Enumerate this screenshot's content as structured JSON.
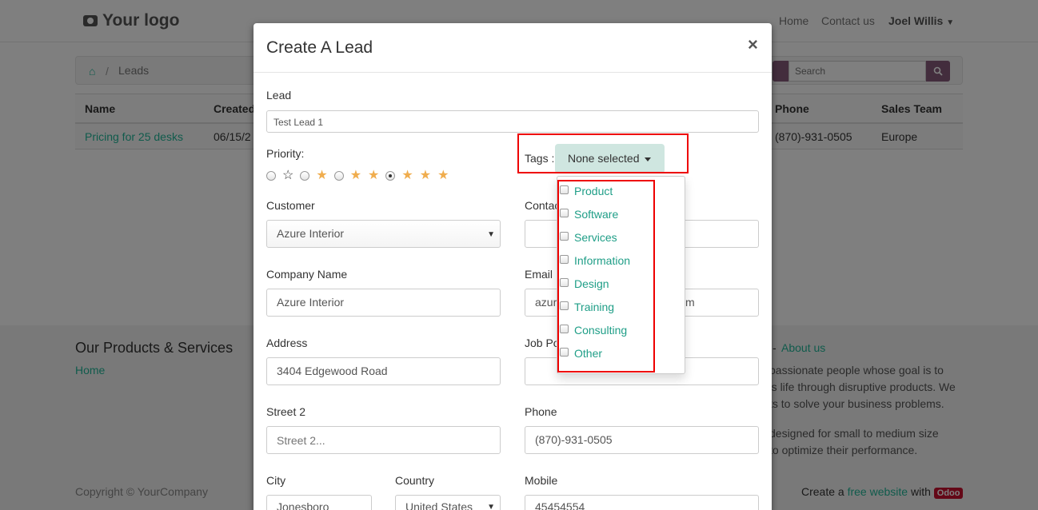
{
  "nav": {
    "logo_text": "Your logo",
    "home": "Home",
    "contact": "Contact us",
    "user": "Joel Willis"
  },
  "breadcrumb": {
    "current": "Leads"
  },
  "search": {
    "placeholder": "Search"
  },
  "table": {
    "headers": [
      "Name",
      "Created",
      "Phone",
      "Sales Team"
    ],
    "row": {
      "name": "Pricing for 25 desks",
      "created": "06/15/2",
      "phone": "(870)-931-0505",
      "team": "Europe"
    }
  },
  "footer": {
    "title": "Our Products & Services",
    "home": "Home",
    "about_prefix": "-",
    "about_link": "About us",
    "about_lines": [
      "passionate people whose goal is to",
      "'s life through disruptive products. We",
      "ts to solve your business problems."
    ],
    "about_lines2": [
      "designed for small to medium size",
      "to optimize their performance."
    ],
    "copyright": "Copyright © YourCompany",
    "create_prefix": "Create a",
    "create_link": "free website",
    "create_with": "with",
    "odoo": "Odoo"
  },
  "modal": {
    "title": "Create A Lead",
    "close": "×",
    "lead_label": "Lead",
    "lead_value": "Test Lead 1",
    "priority_label": "Priority:",
    "tags_label": "Tags :",
    "tags_button": "None selected",
    "tag_options": [
      "Product",
      "Software",
      "Services",
      "Information",
      "Design",
      "Training",
      "Consulting",
      "Other"
    ],
    "customer_label": "Customer",
    "customer_value": "Azure Interior",
    "contact_label": "Contac",
    "company_label": "Company Name",
    "company_value": "Azure Interior",
    "email_label": "Email",
    "email_value_left": "azur",
    "email_value_right": "m",
    "address_label": "Address",
    "address_value": "3404  Edgewood Road",
    "job_label": "Job Po",
    "street2_label": "Street 2",
    "street2_placeholder": "Street 2...",
    "phone_label": "Phone",
    "phone_value": "(870)-931-0505",
    "city_label": "City",
    "city_value": "Jonesboro",
    "country_label": "Country",
    "country_value": "United States",
    "mobile_label": "Mobile",
    "mobile_value": "45454554"
  },
  "colors": {
    "accent": "#21b799",
    "brand": "#875A7B",
    "highlight": "#e00000"
  }
}
